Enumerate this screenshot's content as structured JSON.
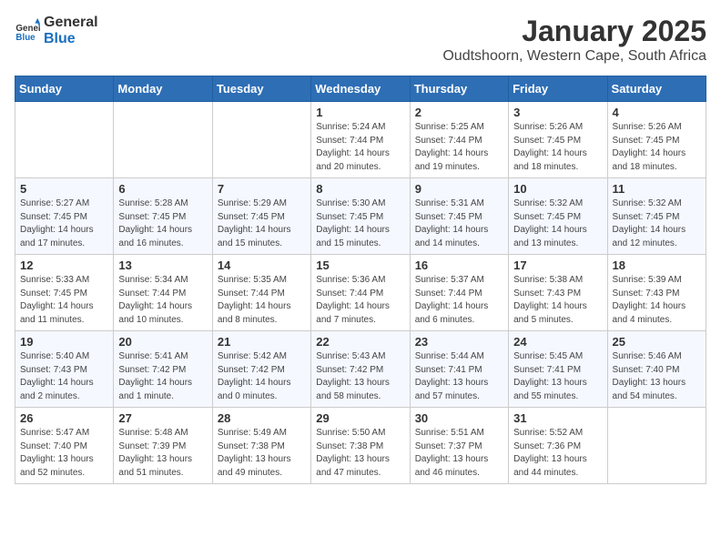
{
  "header": {
    "logo_general": "General",
    "logo_blue": "Blue",
    "month_title": "January 2025",
    "location": "Oudtshoorn, Western Cape, South Africa"
  },
  "weekdays": [
    "Sunday",
    "Monday",
    "Tuesday",
    "Wednesday",
    "Thursday",
    "Friday",
    "Saturday"
  ],
  "weeks": [
    [
      {
        "day": "",
        "sunrise": "",
        "sunset": "",
        "daylight": ""
      },
      {
        "day": "",
        "sunrise": "",
        "sunset": "",
        "daylight": ""
      },
      {
        "day": "",
        "sunrise": "",
        "sunset": "",
        "daylight": ""
      },
      {
        "day": "1",
        "sunrise": "Sunrise: 5:24 AM",
        "sunset": "Sunset: 7:44 PM",
        "daylight": "Daylight: 14 hours and 20 minutes."
      },
      {
        "day": "2",
        "sunrise": "Sunrise: 5:25 AM",
        "sunset": "Sunset: 7:44 PM",
        "daylight": "Daylight: 14 hours and 19 minutes."
      },
      {
        "day": "3",
        "sunrise": "Sunrise: 5:26 AM",
        "sunset": "Sunset: 7:45 PM",
        "daylight": "Daylight: 14 hours and 18 minutes."
      },
      {
        "day": "4",
        "sunrise": "Sunrise: 5:26 AM",
        "sunset": "Sunset: 7:45 PM",
        "daylight": "Daylight: 14 hours and 18 minutes."
      }
    ],
    [
      {
        "day": "5",
        "sunrise": "Sunrise: 5:27 AM",
        "sunset": "Sunset: 7:45 PM",
        "daylight": "Daylight: 14 hours and 17 minutes."
      },
      {
        "day": "6",
        "sunrise": "Sunrise: 5:28 AM",
        "sunset": "Sunset: 7:45 PM",
        "daylight": "Daylight: 14 hours and 16 minutes."
      },
      {
        "day": "7",
        "sunrise": "Sunrise: 5:29 AM",
        "sunset": "Sunset: 7:45 PM",
        "daylight": "Daylight: 14 hours and 15 minutes."
      },
      {
        "day": "8",
        "sunrise": "Sunrise: 5:30 AM",
        "sunset": "Sunset: 7:45 PM",
        "daylight": "Daylight: 14 hours and 15 minutes."
      },
      {
        "day": "9",
        "sunrise": "Sunrise: 5:31 AM",
        "sunset": "Sunset: 7:45 PM",
        "daylight": "Daylight: 14 hours and 14 minutes."
      },
      {
        "day": "10",
        "sunrise": "Sunrise: 5:32 AM",
        "sunset": "Sunset: 7:45 PM",
        "daylight": "Daylight: 14 hours and 13 minutes."
      },
      {
        "day": "11",
        "sunrise": "Sunrise: 5:32 AM",
        "sunset": "Sunset: 7:45 PM",
        "daylight": "Daylight: 14 hours and 12 minutes."
      }
    ],
    [
      {
        "day": "12",
        "sunrise": "Sunrise: 5:33 AM",
        "sunset": "Sunset: 7:45 PM",
        "daylight": "Daylight: 14 hours and 11 minutes."
      },
      {
        "day": "13",
        "sunrise": "Sunrise: 5:34 AM",
        "sunset": "Sunset: 7:44 PM",
        "daylight": "Daylight: 14 hours and 10 minutes."
      },
      {
        "day": "14",
        "sunrise": "Sunrise: 5:35 AM",
        "sunset": "Sunset: 7:44 PM",
        "daylight": "Daylight: 14 hours and 8 minutes."
      },
      {
        "day": "15",
        "sunrise": "Sunrise: 5:36 AM",
        "sunset": "Sunset: 7:44 PM",
        "daylight": "Daylight: 14 hours and 7 minutes."
      },
      {
        "day": "16",
        "sunrise": "Sunrise: 5:37 AM",
        "sunset": "Sunset: 7:44 PM",
        "daylight": "Daylight: 14 hours and 6 minutes."
      },
      {
        "day": "17",
        "sunrise": "Sunrise: 5:38 AM",
        "sunset": "Sunset: 7:43 PM",
        "daylight": "Daylight: 14 hours and 5 minutes."
      },
      {
        "day": "18",
        "sunrise": "Sunrise: 5:39 AM",
        "sunset": "Sunset: 7:43 PM",
        "daylight": "Daylight: 14 hours and 4 minutes."
      }
    ],
    [
      {
        "day": "19",
        "sunrise": "Sunrise: 5:40 AM",
        "sunset": "Sunset: 7:43 PM",
        "daylight": "Daylight: 14 hours and 2 minutes."
      },
      {
        "day": "20",
        "sunrise": "Sunrise: 5:41 AM",
        "sunset": "Sunset: 7:42 PM",
        "daylight": "Daylight: 14 hours and 1 minute."
      },
      {
        "day": "21",
        "sunrise": "Sunrise: 5:42 AM",
        "sunset": "Sunset: 7:42 PM",
        "daylight": "Daylight: 14 hours and 0 minutes."
      },
      {
        "day": "22",
        "sunrise": "Sunrise: 5:43 AM",
        "sunset": "Sunset: 7:42 PM",
        "daylight": "Daylight: 13 hours and 58 minutes."
      },
      {
        "day": "23",
        "sunrise": "Sunrise: 5:44 AM",
        "sunset": "Sunset: 7:41 PM",
        "daylight": "Daylight: 13 hours and 57 minutes."
      },
      {
        "day": "24",
        "sunrise": "Sunrise: 5:45 AM",
        "sunset": "Sunset: 7:41 PM",
        "daylight": "Daylight: 13 hours and 55 minutes."
      },
      {
        "day": "25",
        "sunrise": "Sunrise: 5:46 AM",
        "sunset": "Sunset: 7:40 PM",
        "daylight": "Daylight: 13 hours and 54 minutes."
      }
    ],
    [
      {
        "day": "26",
        "sunrise": "Sunrise: 5:47 AM",
        "sunset": "Sunset: 7:40 PM",
        "daylight": "Daylight: 13 hours and 52 minutes."
      },
      {
        "day": "27",
        "sunrise": "Sunrise: 5:48 AM",
        "sunset": "Sunset: 7:39 PM",
        "daylight": "Daylight: 13 hours and 51 minutes."
      },
      {
        "day": "28",
        "sunrise": "Sunrise: 5:49 AM",
        "sunset": "Sunset: 7:38 PM",
        "daylight": "Daylight: 13 hours and 49 minutes."
      },
      {
        "day": "29",
        "sunrise": "Sunrise: 5:50 AM",
        "sunset": "Sunset: 7:38 PM",
        "daylight": "Daylight: 13 hours and 47 minutes."
      },
      {
        "day": "30",
        "sunrise": "Sunrise: 5:51 AM",
        "sunset": "Sunset: 7:37 PM",
        "daylight": "Daylight: 13 hours and 46 minutes."
      },
      {
        "day": "31",
        "sunrise": "Sunrise: 5:52 AM",
        "sunset": "Sunset: 7:36 PM",
        "daylight": "Daylight: 13 hours and 44 minutes."
      },
      {
        "day": "",
        "sunrise": "",
        "sunset": "",
        "daylight": ""
      }
    ]
  ]
}
